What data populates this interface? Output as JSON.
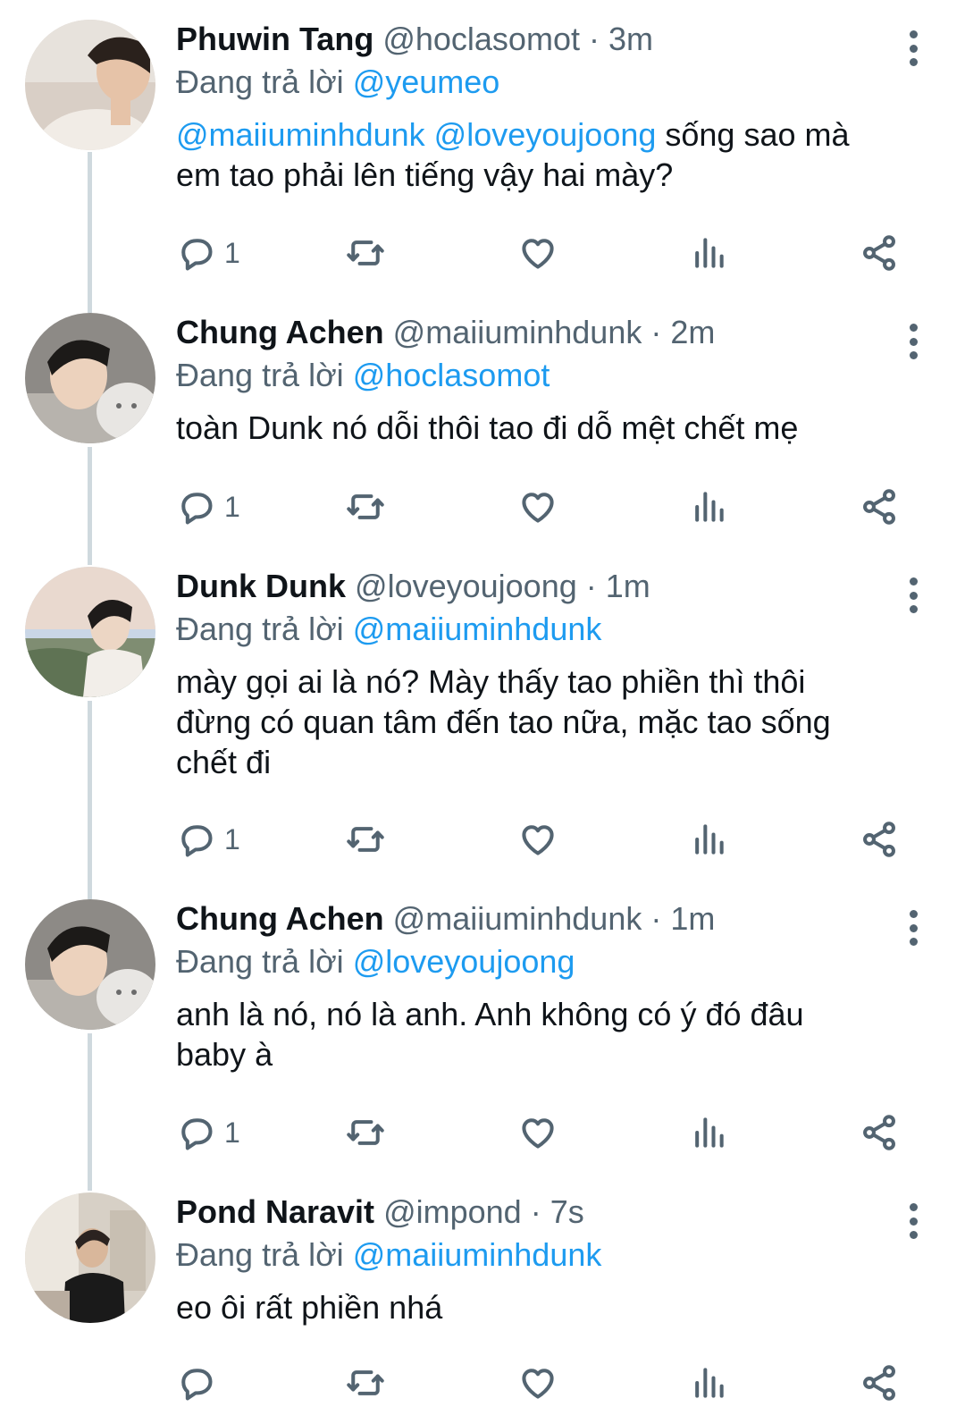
{
  "colors": {
    "accent": "#1d9bf0",
    "text": "#0f1419",
    "muted": "#536471",
    "thread_line": "#cfd9de"
  },
  "reply_prefix": "Đang trả lời",
  "tweets": [
    {
      "name": "Phuwin Tang",
      "handle": "@hoclasomot",
      "time": "· 3m",
      "reply_to": "@yeumeo",
      "mentions": "@maiiuminhdunk @loveyoujoong",
      "text_a": " sống sao mà",
      "text_b": "em tao phải lên tiếng vậy hai mày?",
      "text_c": "",
      "reply_count": "1"
    },
    {
      "name": "Chung Achen",
      "handle": "@maiiuminhdunk",
      "time": "· 2m",
      "reply_to": "@hoclasomot",
      "text_a": "toàn Dunk nó dỗi thôi tao đi dỗ mệt chết mẹ",
      "reply_count": "1"
    },
    {
      "name": "Dunk Dunk",
      "handle": "@loveyoujoong",
      "time": "· 1m",
      "reply_to": "@maiiuminhdunk",
      "text_a": "mày gọi ai là nó? Mày thấy tao phiền thì thôi",
      "text_b": "đừng có quan tâm đến tao nữa, mặc tao sống",
      "text_c": "chết đi",
      "reply_count": "1"
    },
    {
      "name": "Chung Achen",
      "handle": "@maiiuminhdunk",
      "time": "· 1m",
      "reply_to": "@loveyoujoong",
      "text_a": "anh là nó, nó là anh. Anh không có ý đó đâu",
      "text_b": "baby à",
      "reply_count": "1"
    },
    {
      "name": "Pond Naravit",
      "handle": "@impond",
      "time": "· 7s",
      "reply_to": "@maiiuminhdunk",
      "text_a": "eo ôi rất phiền nhá",
      "reply_count": ""
    }
  ],
  "icons": {
    "reply": "reply-icon",
    "retweet": "retweet-icon",
    "like": "heart-icon",
    "views": "views-icon",
    "share": "share-icon",
    "more": "more-icon"
  }
}
